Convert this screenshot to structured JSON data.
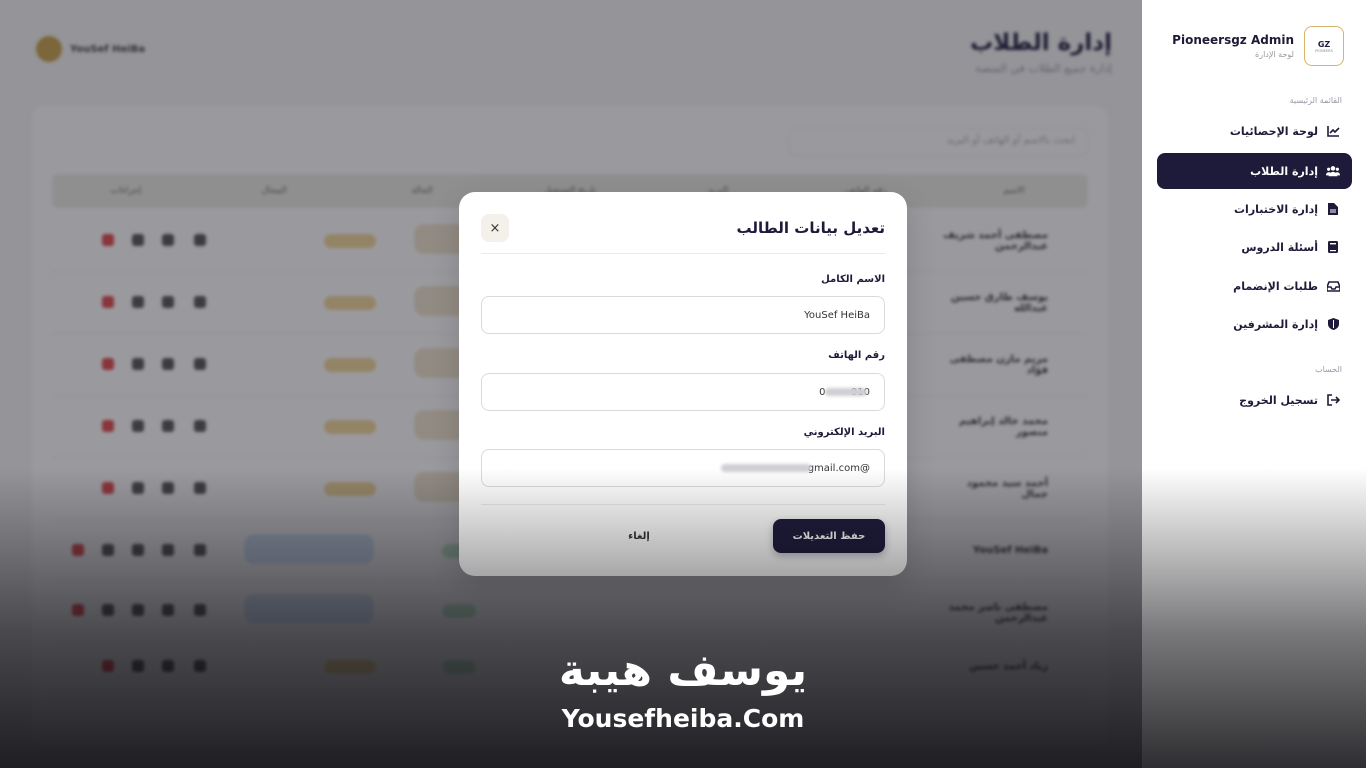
{
  "background": {
    "page_title": "إدارة الطلاب",
    "page_subtitle": "إدارة جميع الطلاب في المنصة",
    "user_name": "YouSef HeiBa",
    "search_placeholder": "ابحث بالاسم أو الهاتف أو البريد",
    "columns": [
      "الاسم",
      "رقم الهاتف",
      "البريد",
      "تاريخ التسجيل",
      "الحالة",
      "المجال",
      "إجراءات"
    ],
    "rows": [
      "مصطفى أحمد شريف عبدالرحمن",
      "يوسف طارق حسين عبدالله",
      "مريم مازن مصطفى فؤاد",
      "محمد خالد إبراهيم منصور",
      "أحمد سيد محمود جمال",
      "YouSef HeiBa",
      "مصطفى ناصر محمد عبدالرحمن",
      "زياد أحمد حسين"
    ]
  },
  "sidebar": {
    "admin_name": "Pioneersgz Admin",
    "panel_label": "لوحة الإدارة",
    "logo_main": "GZ",
    "logo_sub": "PIONEERS",
    "main_menu_label": "القائمة الرئيسية",
    "account_label": "الحساب",
    "items": [
      {
        "label": "لوحة الإحصائيات",
        "icon": "chart-line-icon"
      },
      {
        "label": "إدارة الطلاب",
        "icon": "users-icon"
      },
      {
        "label": "إدارة الاختبارات",
        "icon": "file-icon"
      },
      {
        "label": "أسئلة الدروس",
        "icon": "book-icon"
      },
      {
        "label": "طلبات الإنضمام",
        "icon": "inbox-icon"
      },
      {
        "label": "إدارة المشرفين",
        "icon": "shield-icon"
      }
    ],
    "logout_label": "تسجيل الخروج",
    "accent_color": "#1e1b3a",
    "gold_color": "#d6b56a"
  },
  "modal": {
    "title": "تعديل بيانات الطالب",
    "close_symbol": "×",
    "fields": {
      "name_label": "الاسم الكامل",
      "name_value": "YouSef HeiBa",
      "phone_label": "رقم الهاتف",
      "phone_value": "010        0",
      "email_label": "البريد الإلكتروني",
      "email_value": "@gmail.com"
    },
    "save_label": "حفظ التعديلات",
    "cancel_label": "إلغاء"
  },
  "watermark": {
    "arabic": "يوسف هيبة",
    "english": "Yousefheiba.Com"
  }
}
